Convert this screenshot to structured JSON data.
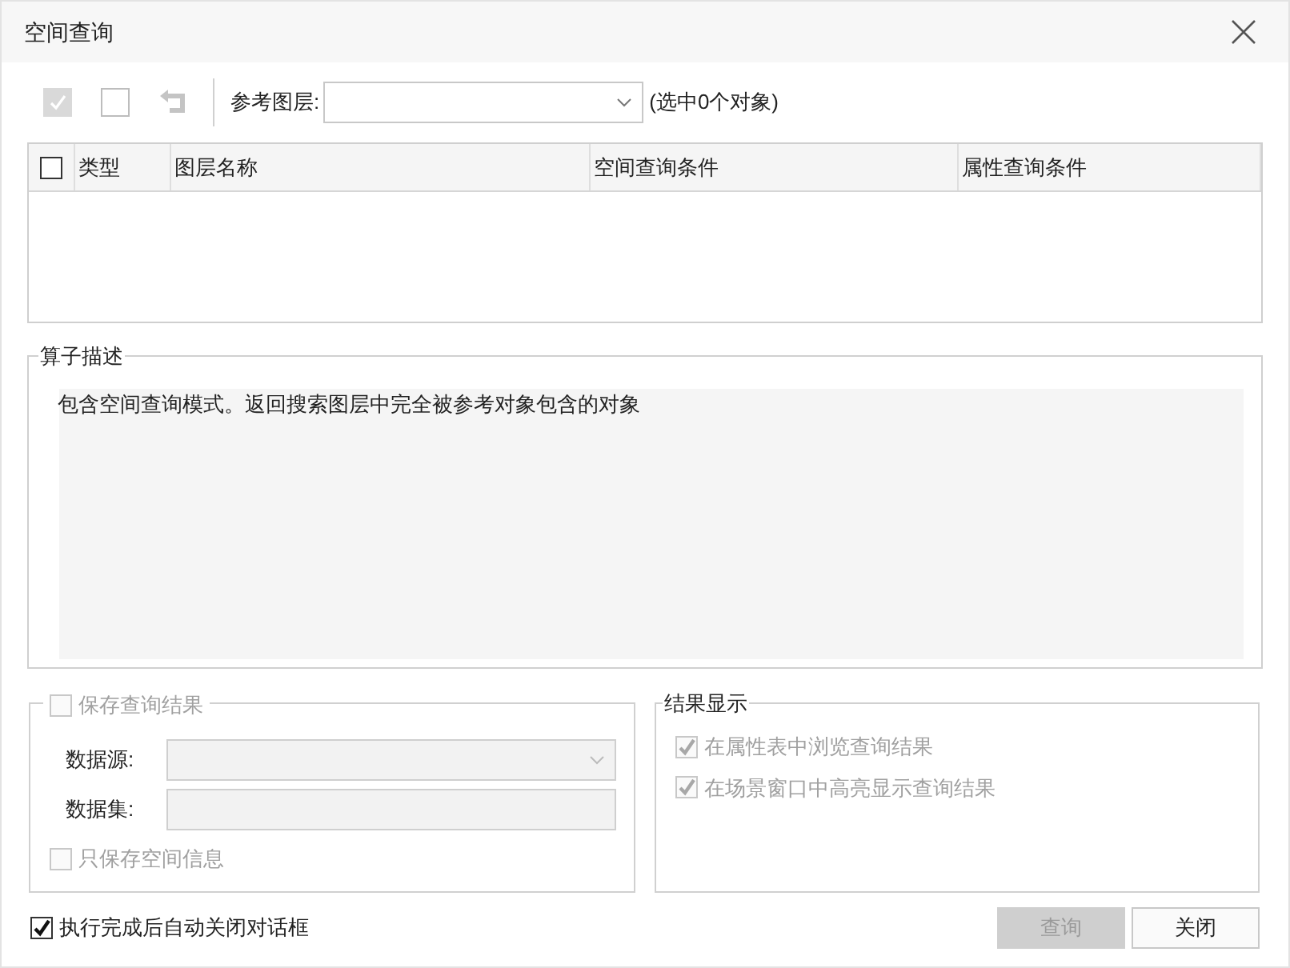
{
  "window": {
    "title": "空间查询"
  },
  "toolbar": {
    "reference_layer": {
      "label": "参考图层:"
    },
    "selection_count": "(选中0个对象)"
  },
  "table": {
    "header_checkbox": {
      "checked": false
    },
    "columns": [
      "类型",
      "图层名称",
      "空间查询条件",
      "属性查询条件"
    ]
  },
  "operator_description": {
    "title": "算子描述",
    "text": "包含空间查询模式。返回搜索图层中完全被参考对象包含的对象"
  },
  "save_results": {
    "label": "保存查询结果",
    "checked": false,
    "disabled": true,
    "fields": [
      {
        "label": "数据源:",
        "kind": "dropdown"
      },
      {
        "label": "数据集:",
        "kind": "text"
      }
    ],
    "spatial_only": {
      "label": "只保存空间信息",
      "checked": false,
      "disabled": true
    }
  },
  "result_display": {
    "title": "结果显示",
    "options": [
      {
        "label": "在属性表中浏览查询结果",
        "checked": true,
        "disabled": true
      },
      {
        "label": "在场景窗口中高亮显示查询结果",
        "checked": true,
        "disabled": true
      }
    ]
  },
  "auto_close": {
    "label": "执行完成后自动关闭对话框",
    "checked": true
  },
  "buttons": [
    {
      "label": "查询",
      "disabled": true
    },
    {
      "label": "关闭",
      "disabled": false
    }
  ]
}
